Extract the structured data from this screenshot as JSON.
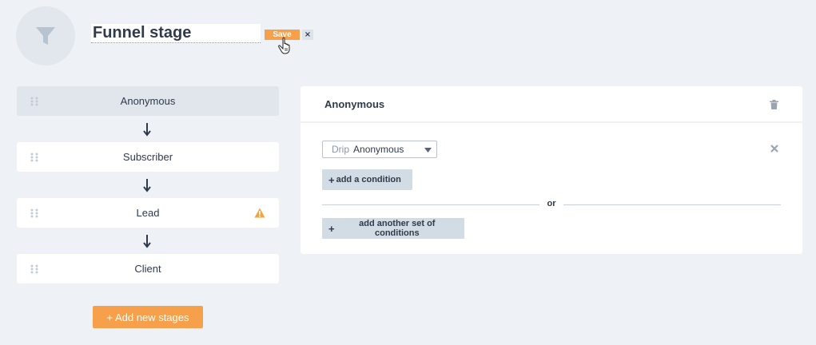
{
  "header": {
    "title_value": "Funnel stage",
    "save_label": "Save",
    "cancel_label": "×",
    "icon": "filter-icon"
  },
  "stages": [
    {
      "label": "Anonymous",
      "active": true,
      "warning": false
    },
    {
      "label": "Subscriber",
      "active": false,
      "warning": false
    },
    {
      "label": "Lead",
      "active": false,
      "warning": true
    },
    {
      "label": "Client",
      "active": false,
      "warning": false
    }
  ],
  "add_stage_label": "+ Add new stages",
  "panel": {
    "title": "Anonymous",
    "condition": {
      "prefix": "Drip",
      "value": "Anonymous"
    },
    "add_condition_label": "add a condition",
    "or_label": "or",
    "add_set_label": "add another set of conditions"
  },
  "colors": {
    "accent": "#f7a04b",
    "background": "#eef1f5",
    "active_stage": "#e1e6ed",
    "secondary_button": "#d2dce5",
    "warning": "#f2a53c"
  }
}
